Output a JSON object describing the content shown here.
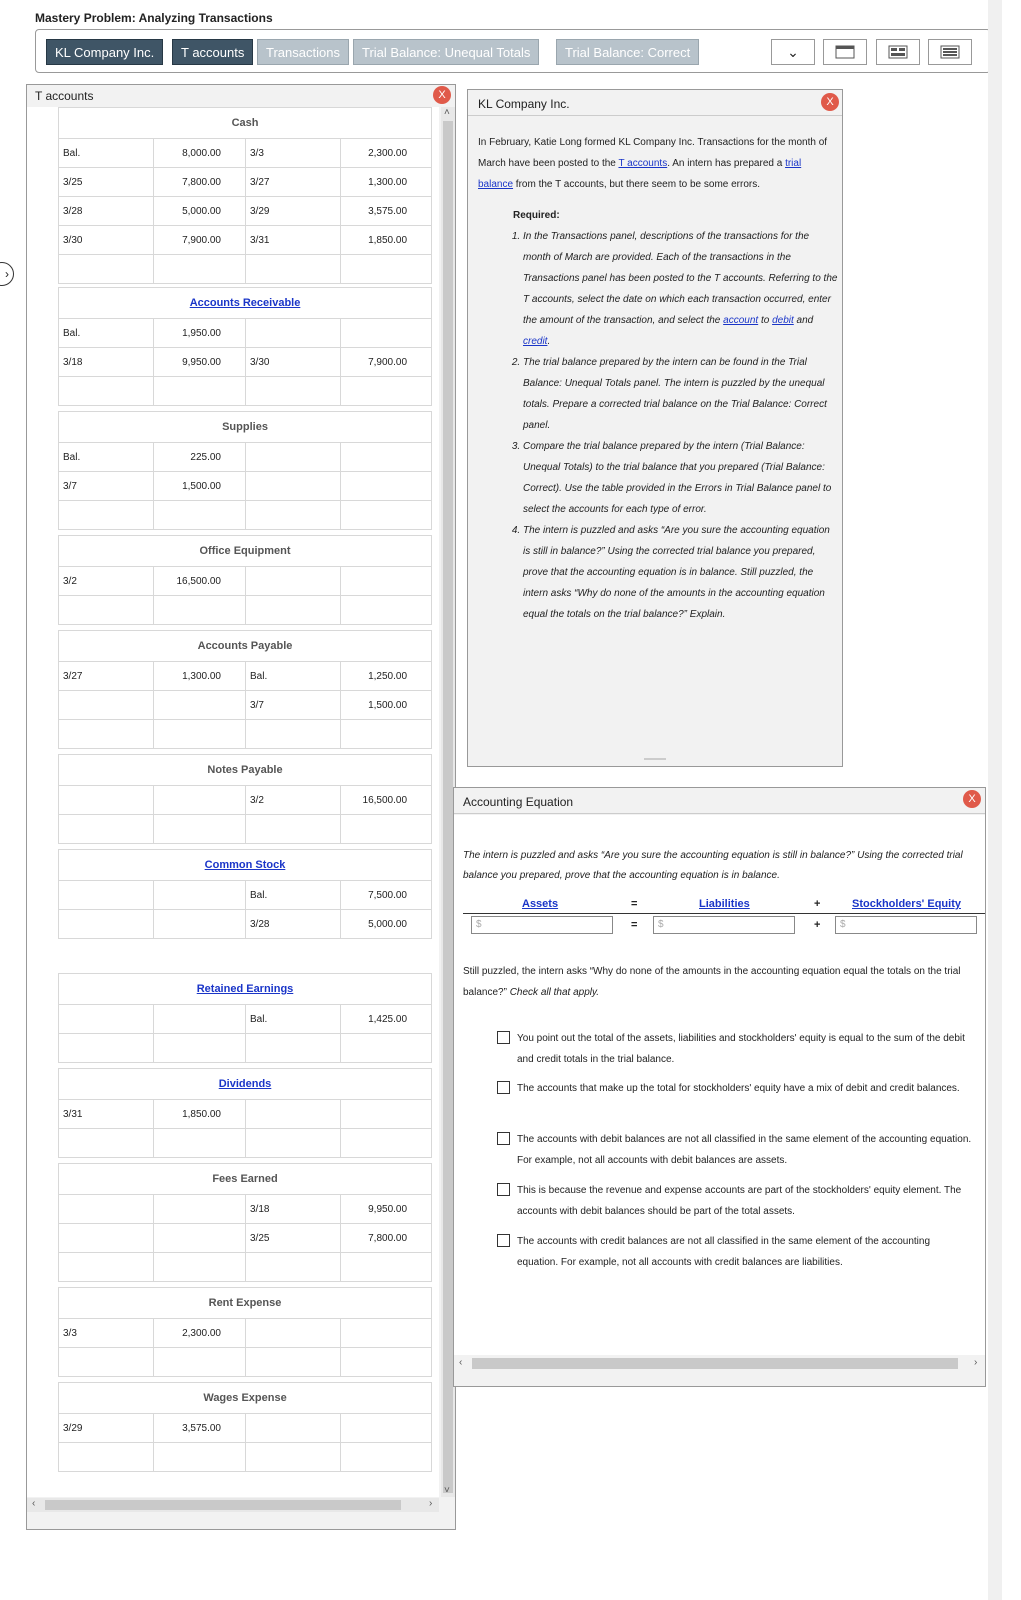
{
  "title": "Mastery Problem: Analyzing Transactions",
  "tabs": [
    {
      "label": "KL Company Inc."
    },
    {
      "label": "T accounts"
    },
    {
      "label": "Transactions"
    },
    {
      "label": "Trial Balance: Unequal Totals"
    },
    {
      "label": "Trial Balance: Correct"
    }
  ],
  "toolbar": {
    "dropdown_icon": "chevron-down-icon",
    "layout_icons": [
      "window-icon",
      "split-layout-icon",
      "list-layout-icon"
    ]
  },
  "tpanel": {
    "title": "T accounts",
    "close": "X",
    "accounts": {
      "cash": {
        "name": "Cash",
        "rows": [
          {
            "ld": "Bal.",
            "la": "8,000.00",
            "rd": "3/3",
            "ra": "2,300.00"
          },
          {
            "ld": "3/25",
            "la": "7,800.00",
            "rd": "3/27",
            "ra": "1,300.00"
          },
          {
            "ld": "3/28",
            "la": "5,000.00",
            "rd": "3/29",
            "ra": "3,575.00"
          },
          {
            "ld": "3/30",
            "la": "7,900.00",
            "rd": "3/31",
            "ra": "1,850.00"
          },
          {
            "ld": "",
            "la": "",
            "rd": "",
            "ra": ""
          }
        ]
      },
      "ar": {
        "name": "Accounts Receivable",
        "rows": [
          {
            "ld": "Bal.",
            "la": "1,950.00",
            "rd": "",
            "ra": ""
          },
          {
            "ld": "3/18",
            "la": "9,950.00",
            "rd": "3/30",
            "ra": "7,900.00"
          },
          {
            "ld": "",
            "la": "",
            "rd": "",
            "ra": ""
          }
        ]
      },
      "supplies": {
        "name": "Supplies",
        "rows": [
          {
            "ld": "Bal.",
            "la": "225.00",
            "rd": "",
            "ra": ""
          },
          {
            "ld": "3/7",
            "la": "1,500.00",
            "rd": "",
            "ra": ""
          },
          {
            "ld": "",
            "la": "",
            "rd": "",
            "ra": ""
          }
        ]
      },
      "oe": {
        "name": "Office Equipment",
        "rows": [
          {
            "ld": "3/2",
            "la": "16,500.00",
            "rd": "",
            "ra": ""
          },
          {
            "ld": "",
            "la": "",
            "rd": "",
            "ra": ""
          }
        ]
      },
      "ap": {
        "name": "Accounts Payable",
        "rows": [
          {
            "ld": "3/27",
            "la": "1,300.00",
            "rd": "Bal.",
            "ra": "1,250.00"
          },
          {
            "ld": "",
            "la": "",
            "rd": "3/7",
            "ra": "1,500.00"
          },
          {
            "ld": "",
            "la": "",
            "rd": "",
            "ra": ""
          }
        ]
      },
      "np": {
        "name": "Notes Payable",
        "rows": [
          {
            "ld": "",
            "la": "",
            "rd": "3/2",
            "ra": "16,500.00"
          },
          {
            "ld": "",
            "la": "",
            "rd": "",
            "ra": ""
          }
        ]
      },
      "cs": {
        "name": "Common Stock",
        "rows": [
          {
            "ld": "",
            "la": "",
            "rd": "Bal.",
            "ra": "7,500.00"
          },
          {
            "ld": "",
            "la": "",
            "rd": "3/28",
            "ra": "5,000.00"
          }
        ]
      },
      "re": {
        "name": "Retained Earnings",
        "rows": [
          {
            "ld": "",
            "la": "",
            "rd": "Bal.",
            "ra": "1,425.00"
          },
          {
            "ld": "",
            "la": "",
            "rd": "",
            "ra": ""
          }
        ]
      },
      "div": {
        "name": "Dividends",
        "rows": [
          {
            "ld": "3/31",
            "la": "1,850.00",
            "rd": "",
            "ra": ""
          },
          {
            "ld": "",
            "la": "",
            "rd": "",
            "ra": ""
          }
        ]
      },
      "fees": {
        "name": "Fees Earned",
        "rows": [
          {
            "ld": "",
            "la": "",
            "rd": "3/18",
            "ra": "9,950.00"
          },
          {
            "ld": "",
            "la": "",
            "rd": "3/25",
            "ra": "7,800.00"
          },
          {
            "ld": "",
            "la": "",
            "rd": "",
            "ra": ""
          }
        ]
      },
      "rent": {
        "name": "Rent Expense",
        "rows": [
          {
            "ld": "3/3",
            "la": "2,300.00",
            "rd": "",
            "ra": ""
          },
          {
            "ld": "",
            "la": "",
            "rd": "",
            "ra": ""
          }
        ]
      },
      "wages": {
        "name": "Wages Expense",
        "rows": [
          {
            "ld": "3/29",
            "la": "3,575.00",
            "rd": "",
            "ra": ""
          },
          {
            "ld": "",
            "la": "",
            "rd": "",
            "ra": ""
          }
        ]
      }
    }
  },
  "klpanel": {
    "title": "KL Company Inc.",
    "close": "X",
    "intro1": "In February, Katie Long formed KL Company Inc. Transactions for the month of March have been posted to the ",
    "intro_link1": "T accounts",
    "intro2": ". An intern has prepared a ",
    "intro_link2": "trial balance",
    "intro3": " from the T accounts, but there seem to be some errors.",
    "required": "Required:",
    "item1a": "In the Transactions panel, descriptions of the transactions for the month of March are provided. Each of the transactions in the Transactions panel has been posted to the T accounts. Referring to the T accounts, select the date on which each transaction occurred, enter the amount of the transaction, and select the ",
    "item1_link_account": "account",
    "item1_to": " to ",
    "item1_link_debit": "debit",
    "item1_and": " and ",
    "item1_link_credit": "credit",
    "item1_end": ".",
    "item2": "The trial balance prepared by the intern can be found in the Trial Balance: Unequal Totals panel. The intern is puzzled by the unequal totals. Prepare a corrected trial balance on the Trial Balance: Correct panel.",
    "item3": "Compare the trial balance prepared by the intern (Trial Balance: Unequal Totals) to the trial balance that you prepared (Trial Balance: Correct). Use the table provided in the Errors in Trial Balance panel to select the accounts for each type of error.",
    "item4": "The intern is puzzled and asks “Are you sure the accounting equation is still in balance?” Using the corrected trial balance you prepared, prove that the accounting equation is in balance. Still puzzled, the intern asks “Why do none of the amounts in the accounting equation equal the totals on the trial balance?” Explain."
  },
  "aepanel": {
    "title": "Accounting Equation",
    "close": "X",
    "prompt": "The intern is puzzled and asks “Are you sure the accounting equation is still in balance?” Using the corrected trial balance you prepared, prove that the accounting equation is in balance.",
    "assets_label": "Assets",
    "liabilities_label": "Liabilities",
    "se_label": "Stockholders' Equity",
    "equals": "=",
    "plus": "+",
    "assets_placeholder": "$",
    "liabilities_placeholder": "$",
    "se_placeholder": "$",
    "question": "Still puzzled, the intern asks “Why do none of the amounts in the accounting equation equal the totals on the trial balance?”",
    "question_instr": "Check all that apply.",
    "options": [
      "You point out the total of the assets, liabilities and stockholders' equity is equal to the sum of the debit and credit totals in the trial balance.",
      "The accounts that make up the total for stockholders' equity have a mix of debit and credit balances.",
      "The accounts with debit balances are not all classified in the same element of the accounting equation. For example, not all accounts with debit balances are assets.",
      "This is because the revenue and expense accounts are part of the stockholders' equity element. The accounts with debit balances should be part of the total assets.",
      "The accounts with credit balances are not all classified in the same element of the accounting equation. For example, not all accounts with credit balances are liabilities."
    ]
  }
}
